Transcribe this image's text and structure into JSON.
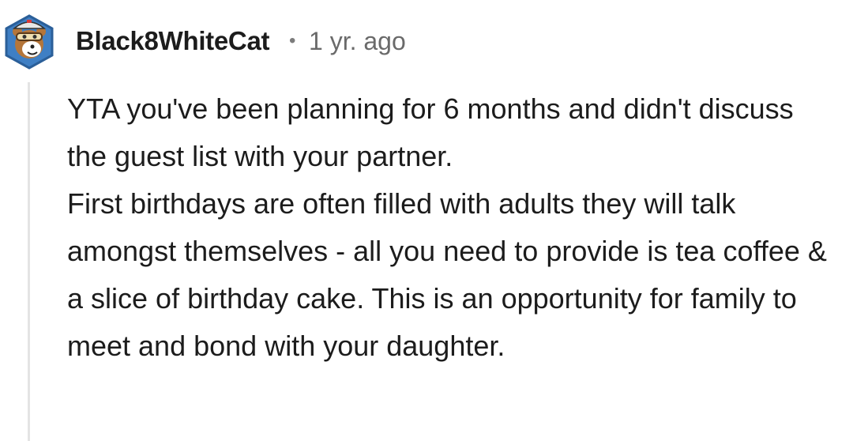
{
  "comment": {
    "author": "Black8WhiteCat",
    "separator": "•",
    "timestamp": "1 yr. ago",
    "avatar_icon": "snoo-avatar-icon",
    "paragraphs": [
      "YTA you've been planning for 6 months and didn't discuss the guest list with your partner.",
      "First birthdays are often filled with adults they will talk amongst themselves - all you need to provide is tea coffee & a slice of birthday cake. This is an opportunity for family to meet and bond with your daughter."
    ]
  },
  "colors": {
    "text": "#1c1c1c",
    "meta": "#6a6a6a",
    "thread_line": "#e4e4e4",
    "avatar_bg": "#3f7fc4",
    "avatar_hex": "#2b5f99"
  }
}
